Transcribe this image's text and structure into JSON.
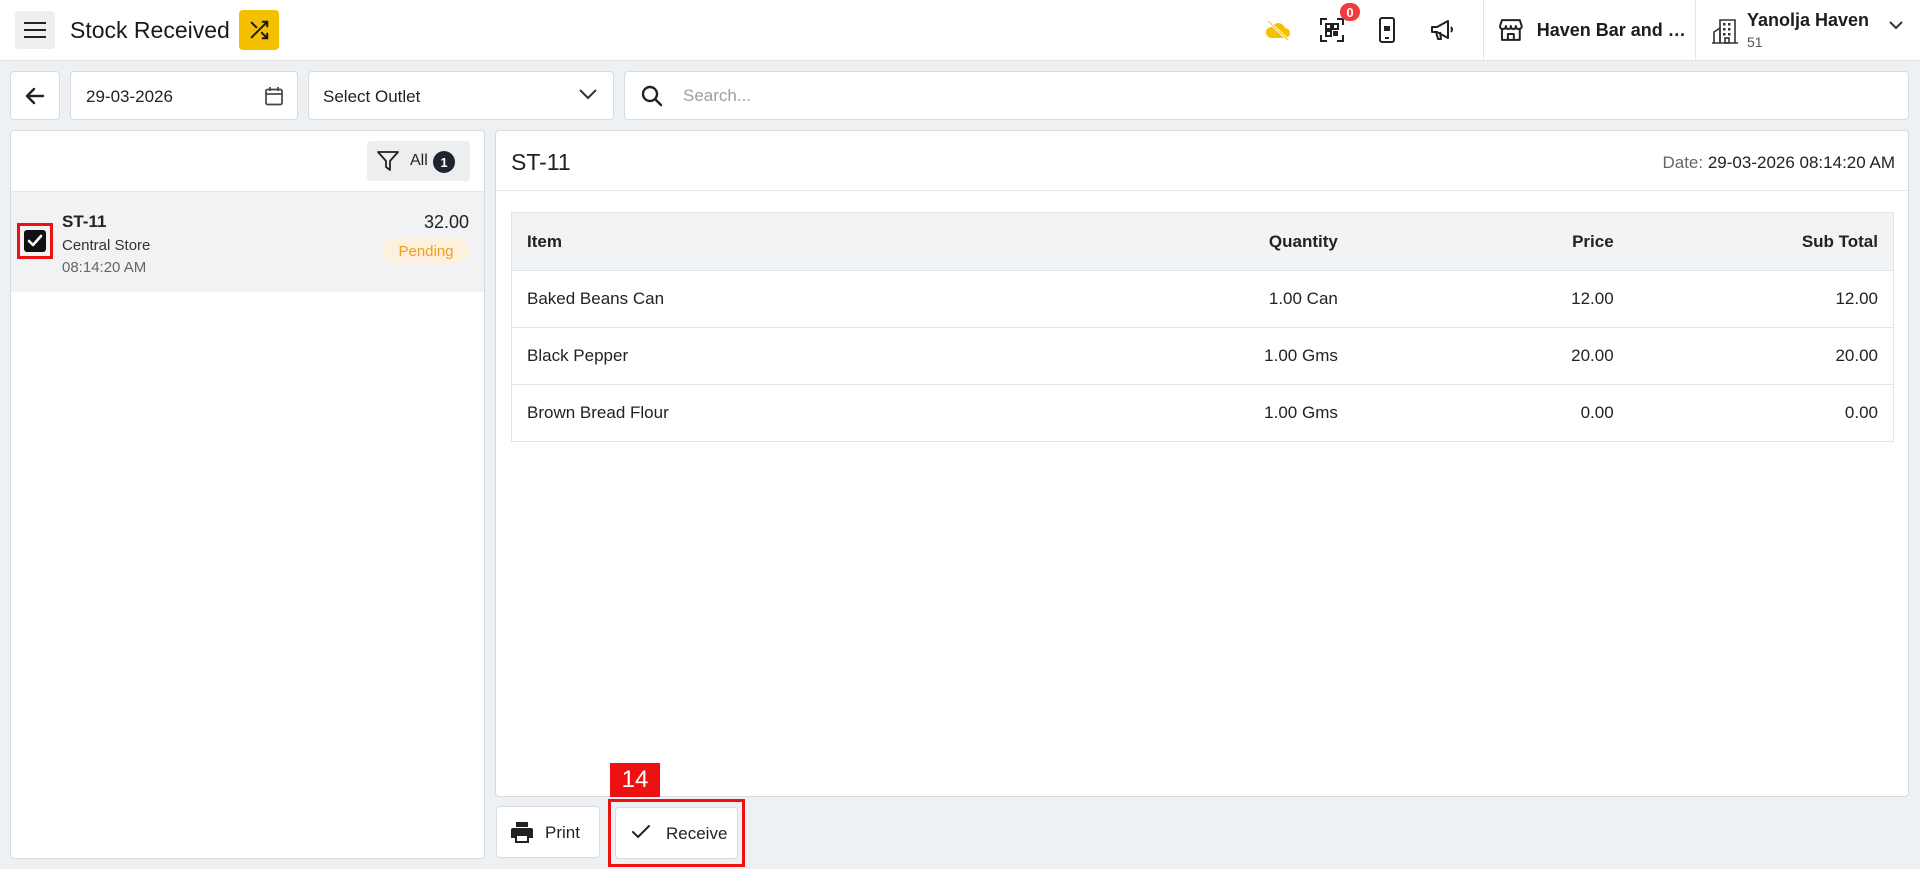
{
  "header": {
    "title": "Stock Received",
    "notification_count": "0",
    "outlet_name": "Haven Bar and R...",
    "property_name": "Yanolja Haven",
    "property_id": "51"
  },
  "toolbar": {
    "date": "29-03-2026",
    "outlet_select": "Select Outlet",
    "search_placeholder": "Search..."
  },
  "list": {
    "filter_label": "All",
    "filter_count": "1",
    "items": [
      {
        "code": "ST-11",
        "store": "Central Store",
        "time": "08:14:20 AM",
        "amount": "32.00",
        "status": "Pending"
      }
    ]
  },
  "detail": {
    "code": "ST-11",
    "date_label": "Date:",
    "date_value": "29-03-2026 08:14:20 AM",
    "columns": [
      "Item",
      "Quantity",
      "Price",
      "Sub Total"
    ],
    "rows": [
      [
        "Baked Beans Can",
        "1.00 Can",
        "12.00",
        "12.00"
      ],
      [
        "Black Pepper",
        "1.00 Gms",
        "20.00",
        "20.00"
      ],
      [
        "Brown Bread Flour",
        "1.00 Gms",
        "0.00",
        "0.00"
      ]
    ]
  },
  "actions": {
    "print_label": "Print",
    "receive_label": "Receive",
    "step_marker": "14"
  },
  "colors": {
    "accent_yellow": "#f5c000",
    "pending_text": "#f39c1f",
    "pending_bg": "#fdf0dc",
    "highlight_red": "#ee1111",
    "badge_red": "#ef3b3b"
  }
}
